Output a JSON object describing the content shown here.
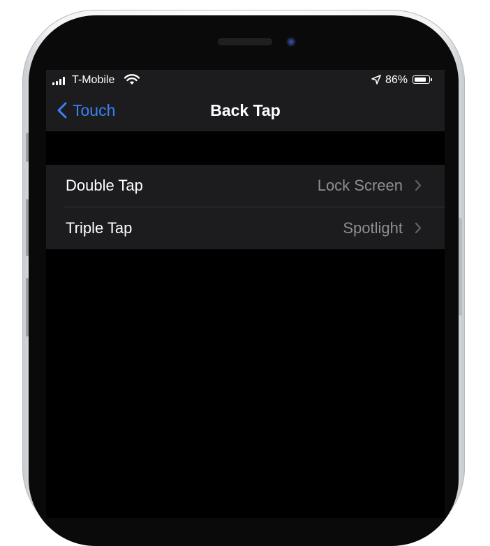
{
  "status_bar": {
    "carrier": "T-Mobile",
    "battery_percent": "86%",
    "battery_level": 0.86,
    "icons": [
      "signal-icon",
      "wifi-icon",
      "location-arrow-icon",
      "battery-icon"
    ]
  },
  "nav": {
    "back_label": "Touch",
    "title": "Back Tap",
    "accent_color": "#3a82f7"
  },
  "options": [
    {
      "label": "Double Tap",
      "value": "Lock Screen"
    },
    {
      "label": "Triple Tap",
      "value": "Spotlight"
    }
  ]
}
